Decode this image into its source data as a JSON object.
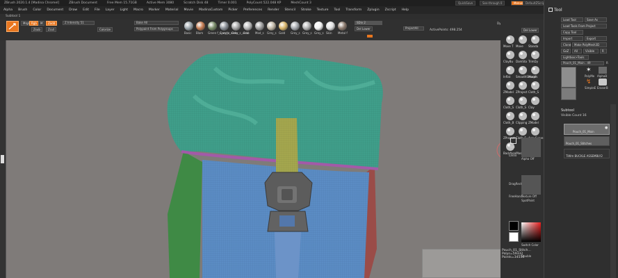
{
  "title_bar": {
    "app_title": "ZBrush 2020.1.4 [Madina Chromel]",
    "document": "ZBrush Document",
    "free_mem": "Free Mem 15.71GB",
    "active_mem": "Active Mem 3080",
    "scratch_disk": "Scratch Disk 48",
    "timer": "Timer 0.001",
    "poly_count": "PolyCount 522.048 KP",
    "mesh_count": "MeshCount 3",
    "quicksave": "QuickSave",
    "see_through": "See-through 0",
    "menus": "Menus",
    "default_script": "DefaultZScript"
  },
  "menu_bar": [
    "Alpha",
    "Brush",
    "Color",
    "Document",
    "Draw",
    "Edit",
    "File",
    "Layer",
    "Light",
    "Macro",
    "Marker",
    "Material",
    "Movie",
    "MadinaCustom",
    "Picker",
    "Preferences",
    "Render",
    "Stencil",
    "Stroke",
    "Texture",
    "Tool",
    "Transform",
    "Zplugin",
    "Zscript",
    "Help"
  ],
  "subtool_tab": "Subtool 1",
  "shelf": {
    "mrgb": "Mrgb",
    "rgb": "Rgb",
    "m": "M",
    "zadd": "Zadd",
    "zsub": "Zsub",
    "zcut": "Zcut",
    "focal_shift": "Z Intensity 51",
    "colorize": "Colorize",
    "bake_all": "Bake All",
    "polypaint_from": "Polypaint From Polygroups",
    "matcap_labels": [
      "Basic",
      "Blom",
      "Green f_s_undo",
      "Grey_v_undo",
      "Grey_s_undo",
      "Scul",
      "Mod_s",
      "Grey_s",
      "Gold",
      "Grey_s",
      "Grey_s",
      "Grey_s",
      "Skin",
      "Metal f"
    ],
    "del_lower": "Del Lower",
    "del_higher": "Del Higher",
    "project_all": "ProjectAll",
    "sdiv": "SDiv 2",
    "active_points": "ActivePoints: 498.254",
    "dyna": "Dyna"
  },
  "right_shelf": {
    "brushes": [
      "Move T",
      "Move",
      "Standa",
      "ClayBu",
      "DamSta",
      "TrimDy",
      "Inflat",
      "SmoothSmooth",
      "Morph",
      "ZModel",
      "ZProject",
      "Cloth_S",
      "Cloth_S",
      "Cloth_S",
      "Clay",
      "Cloth_B",
      "Clipping",
      "ZModel",
      "ZProject",
      "Cloth_F",
      "AccuCurve",
      "BackfaceMask"
    ],
    "stroke": [
      "Rect",
      "Lasso"
    ],
    "alpha_off": "Alpha Off",
    "texture_off": "Texture Off",
    "stroke_type": "DragRect",
    "freehand": "FreeHand",
    "spotlight": "SpotPaint",
    "switch_color": "Switch Color",
    "double": "Double",
    "gradient": "Gradient"
  },
  "stats": {
    "pouch": "Pouch_01_Stitch...",
    "polys": "Polys=59332",
    "points": "Points=34556"
  },
  "tool_panel": {
    "heading": "Tool",
    "load_tool": "Load Tool",
    "save_as": "Save As",
    "load_from_project": "Load Tools From Project",
    "copy_tool": "Copy Tool",
    "import": "Import",
    "export": "Export",
    "clone": "Clone",
    "make_polymesh": "Make PolyMesh3D",
    "goz": "GoZ",
    "all": "All",
    "visible": "Visible",
    "r": "R",
    "lightbox_tools": "Lightbox>Tools",
    "current_tool": "Pouch_01_Main . 49",
    "r_label": "R",
    "tool_names": [
      "PolyMe",
      "AlphaB",
      "SimpleE",
      "EraserB"
    ],
    "subtool_heading": "Subtool",
    "visible_count": "Visible Count 16",
    "subtools": [
      "Pouch_01_Main",
      "Pouch_01_Stitches",
      "TiWm BUCKLE ASSEMBLY2"
    ]
  }
}
